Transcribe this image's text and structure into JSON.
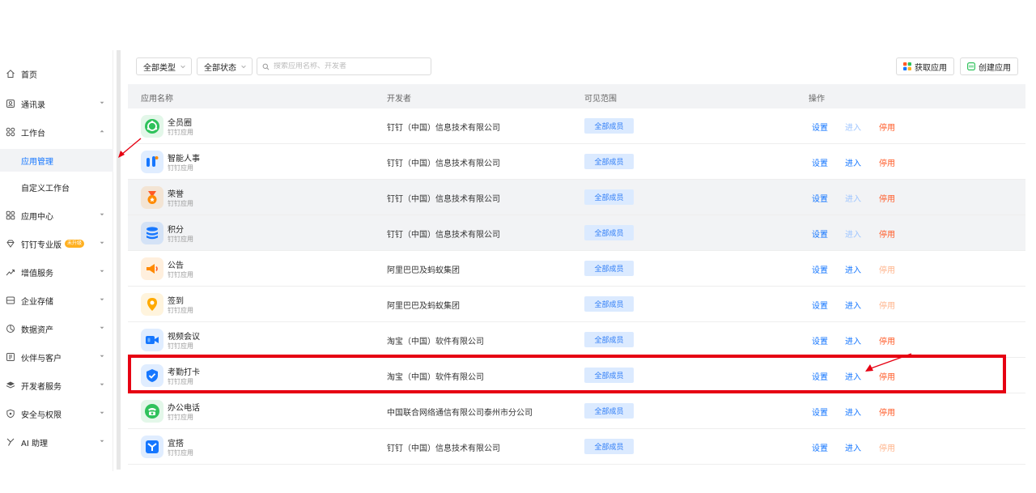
{
  "sidebar": {
    "items": [
      {
        "label": "首页",
        "icon": "home-icon",
        "chevron": false,
        "sub": false,
        "active": false
      },
      {
        "label": "通讯录",
        "icon": "contacts-icon",
        "chevron": "down",
        "sub": false,
        "active": false
      },
      {
        "label": "工作台",
        "icon": "grid-icon",
        "chevron": "up",
        "sub": false,
        "active": false
      },
      {
        "label": "应用管理",
        "icon": "",
        "chevron": false,
        "sub": true,
        "active": true
      },
      {
        "label": "自定义工作台",
        "icon": "",
        "chevron": false,
        "sub": true,
        "active": false
      },
      {
        "label": "应用中心",
        "icon": "apps-icon",
        "chevron": "down",
        "sub": false,
        "active": false
      },
      {
        "label": "钉钉专业版",
        "icon": "diamond-icon",
        "chevron": "down",
        "sub": false,
        "active": false,
        "badge": "未升级"
      },
      {
        "label": "增值服务",
        "icon": "trend-icon",
        "chevron": "down",
        "sub": false,
        "active": false
      },
      {
        "label": "企业存储",
        "icon": "storage-icon",
        "chevron": "down",
        "sub": false,
        "active": false
      },
      {
        "label": "数据资产",
        "icon": "data-icon",
        "chevron": "down",
        "sub": false,
        "active": false
      },
      {
        "label": "伙伴与客户",
        "icon": "partner-icon",
        "chevron": "down",
        "sub": false,
        "active": false
      },
      {
        "label": "开发者服务",
        "icon": "layers-icon",
        "chevron": "down",
        "sub": false,
        "active": false
      },
      {
        "label": "安全与权限",
        "icon": "shield-icon",
        "chevron": "down",
        "sub": false,
        "active": false
      },
      {
        "label": "AI 助理",
        "icon": "ai-icon",
        "chevron": "down",
        "sub": false,
        "active": false
      }
    ]
  },
  "toolbar": {
    "type_filter": "全部类型",
    "status_filter": "全部状态",
    "search_placeholder": "搜索应用名称、开发者",
    "get_app_label": "获取应用",
    "create_app_label": "创建应用"
  },
  "table": {
    "headers": {
      "name": "应用名称",
      "developer": "开发者",
      "scope": "可见范围",
      "actions": "操作"
    },
    "action_labels": {
      "settings": "设置",
      "enter": "进入",
      "disable": "停用"
    },
    "rows": [
      {
        "name": "全员圈",
        "type": "钉钉应用",
        "developer": "钉钉（中国）信息技术有限公司",
        "scope": "全部成员",
        "icon": "circle-app-icon",
        "color": "#2fc25b",
        "enter_active": false,
        "disable_active": true
      },
      {
        "name": "智能人事",
        "type": "钉钉应用",
        "developer": "钉钉（中国）信息技术有限公司",
        "scope": "全部成员",
        "icon": "hr-app-icon",
        "color": "#1677ff",
        "enter_active": true,
        "disable_active": true
      },
      {
        "name": "荣誉",
        "type": "钉钉应用",
        "developer": "钉钉（中国）信息技术有限公司",
        "scope": "全部成员",
        "icon": "medal-app-icon",
        "color": "#ff8a00",
        "enter_active": false,
        "disable_active": true
      },
      {
        "name": "积分",
        "type": "钉钉应用",
        "developer": "钉钉（中国）信息技术有限公司",
        "scope": "全部成员",
        "icon": "points-app-icon",
        "color": "#1677ff",
        "enter_active": false,
        "disable_active": true
      },
      {
        "name": "公告",
        "type": "钉钉应用",
        "developer": "阿里巴巴及蚂蚁集团",
        "scope": "全部成员",
        "icon": "announcement-app-icon",
        "color": "#ff8a00",
        "enter_active": true,
        "disable_active": false
      },
      {
        "name": "签到",
        "type": "钉钉应用",
        "developer": "阿里巴巴及蚂蚁集团",
        "scope": "全部成员",
        "icon": "checkin-app-icon",
        "color": "#ffaa00",
        "enter_active": true,
        "disable_active": false
      },
      {
        "name": "视频会议",
        "type": "钉钉应用",
        "developer": "淘宝（中国）软件有限公司",
        "scope": "全部成员",
        "icon": "video-meeting-app-icon",
        "color": "#1677ff",
        "enter_active": true,
        "disable_active": true
      },
      {
        "name": "考勤打卡",
        "type": "钉钉应用",
        "developer": "淘宝（中国）软件有限公司",
        "scope": "全部成员",
        "icon": "attendance-app-icon",
        "color": "#1677ff",
        "enter_active": true,
        "disable_active": true
      },
      {
        "name": "办公电话",
        "type": "钉钉应用",
        "developer": "中国联合网络通信有限公司泰州市分公司",
        "scope": "全部成员",
        "icon": "phone-app-icon",
        "color": "#2fc25b",
        "enter_active": true,
        "disable_active": true
      },
      {
        "name": "宜搭",
        "type": "钉钉应用",
        "developer": "钉钉（中国）信息技术有限公司",
        "scope": "全部成员",
        "icon": "yida-app-icon",
        "color": "#1677ff",
        "enter_active": true,
        "disable_active": false
      }
    ]
  },
  "annotation_color": "#e60012"
}
